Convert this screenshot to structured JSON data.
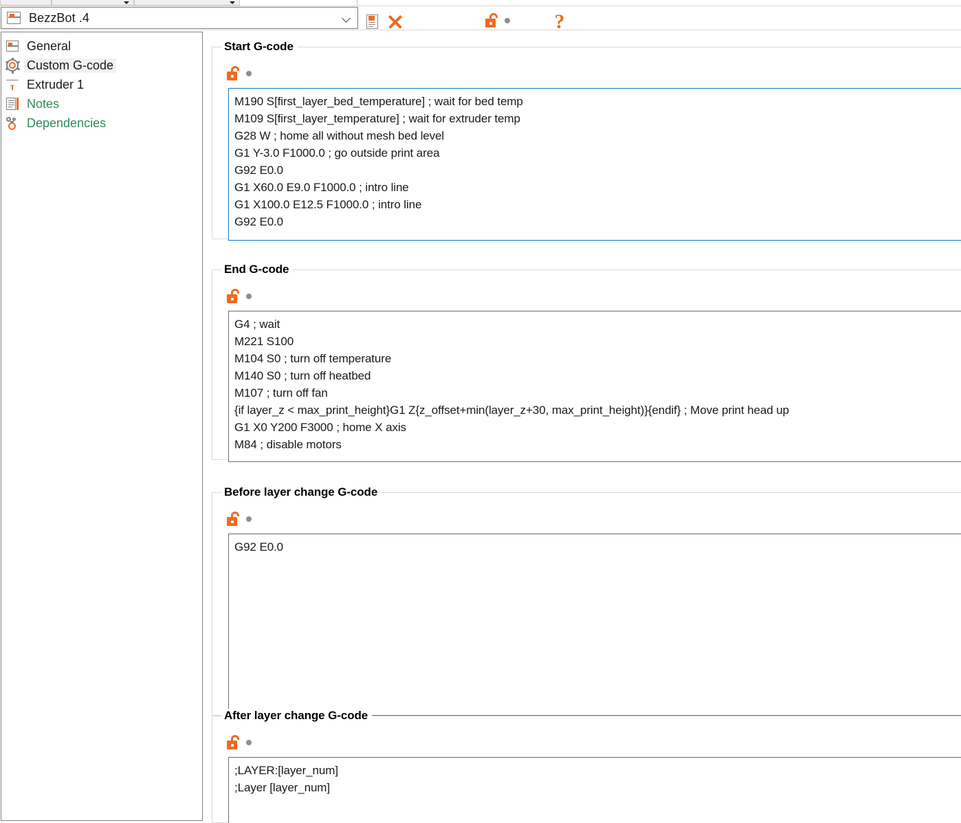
{
  "window": {
    "preset_name": "BezzBot .4"
  },
  "toolbar": {
    "preset_icon": "printer-preset-icon",
    "save_label": "",
    "delete_label": "",
    "lock_label": "",
    "help_label": "?"
  },
  "sidebar": {
    "items": [
      {
        "label": "General",
        "icon": "general-icon",
        "selected": false,
        "green": false
      },
      {
        "label": "Custom G-code",
        "icon": "gear-icon",
        "selected": true,
        "green": false
      },
      {
        "label": "Extruder 1",
        "icon": "extruder-icon",
        "selected": false,
        "green": false
      },
      {
        "label": "Notes",
        "icon": "notes-icon",
        "selected": false,
        "green": true
      },
      {
        "label": "Dependencies",
        "icon": "dependencies-icon",
        "selected": false,
        "green": true
      }
    ]
  },
  "sections": [
    {
      "title": "Start G-code",
      "focused": true,
      "lines": [
        "M190 S[first_layer_bed_temperature] ; wait for bed temp",
        "M109 S[first_layer_temperature] ; wait for extruder temp",
        "G28 W ; home all without mesh bed level",
        "G1 Y-3.0 F1000.0 ; go outside print area",
        "G92 E0.0",
        "G1 X60.0 E9.0 F1000.0 ; intro line",
        "G1 X100.0 E12.5 F1000.0 ; intro line",
        "G92 E0.0"
      ]
    },
    {
      "title": "End G-code",
      "focused": false,
      "lines": [
        "G4 ; wait",
        "M221 S100",
        "M104 S0 ; turn off temperature",
        "M140 S0 ; turn off heatbed",
        "M107 ; turn off fan",
        "{if layer_z < max_print_height}G1 Z{z_offset+min(layer_z+30, max_print_height)}{endif} ; Move print head up",
        "G1 X0 Y200 F3000 ; home X axis",
        "M84 ; disable motors"
      ]
    },
    {
      "title": "Before layer change G-code",
      "focused": false,
      "lines": [
        "G92 E0.0"
      ]
    },
    {
      "title": "After layer change G-code",
      "focused": false,
      "lines": [
        ";LAYER:[layer_num]",
        ";Layer [layer_num]"
      ]
    }
  ],
  "colors": {
    "accent": "#ed6b21",
    "focus_border": "#1878c8",
    "green_text": "#2e8b57",
    "border": "#7f7f7f"
  }
}
